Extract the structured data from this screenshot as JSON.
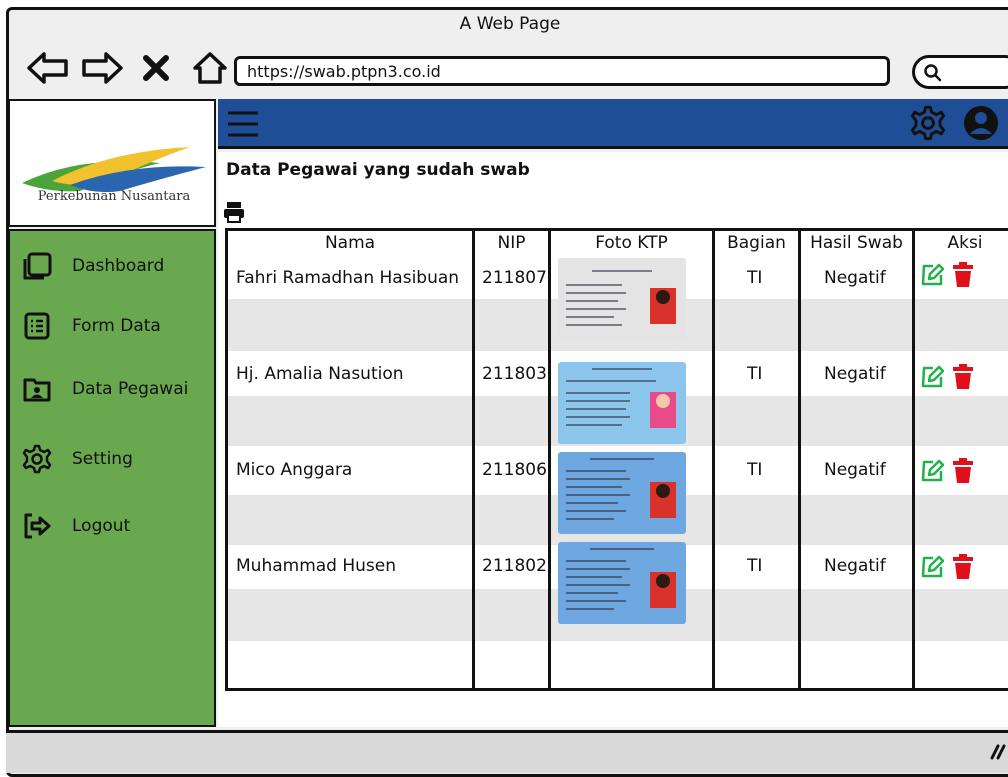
{
  "window": {
    "title": "A Web Page"
  },
  "browser": {
    "url": "https://swab.ptpn3.co.id"
  },
  "brand": {
    "logo_text": "Perkebunan Nusantara"
  },
  "sidebar": {
    "items": [
      {
        "label": "Dashboard",
        "icon": "dashboard-icon"
      },
      {
        "label": "Form Data",
        "icon": "form-icon"
      },
      {
        "label": "Data Pegawai",
        "icon": "employee-icon"
      },
      {
        "label": "Setting",
        "icon": "gear-icon"
      },
      {
        "label": "Logout",
        "icon": "logout-icon"
      }
    ]
  },
  "page": {
    "title": "Data Pegawai yang sudah swab"
  },
  "table": {
    "headers": [
      "Nama",
      "NIP",
      "Foto KTP",
      "Bagian",
      "Hasil Swab",
      "Aksi"
    ],
    "rows": [
      {
        "nama": "Fahri Ramadhan Hasibuan",
        "nip": "211807",
        "bagian": "TI",
        "hasil": "Negatif",
        "ktp_color": "#e4e4e4"
      },
      {
        "nama": "Hj. Amalia Nasution",
        "nip": "211803",
        "bagian": "TI",
        "hasil": "Negatif",
        "ktp_color": "#8cc6ec"
      },
      {
        "nama": "Mico Anggara",
        "nip": "211806",
        "bagian": "TI",
        "hasil": "Negatif",
        "ktp_color": "#6fa8e0"
      },
      {
        "nama": "Muhammad Husen",
        "nip": "211802",
        "bagian": "TI",
        "hasil": "Negatif",
        "ktp_color": "#6fa8e0"
      }
    ]
  },
  "colors": {
    "topbar": "#1f4e96",
    "sidebar": "#6aa84f",
    "edit": "#22b14c",
    "delete": "#e0101a"
  }
}
